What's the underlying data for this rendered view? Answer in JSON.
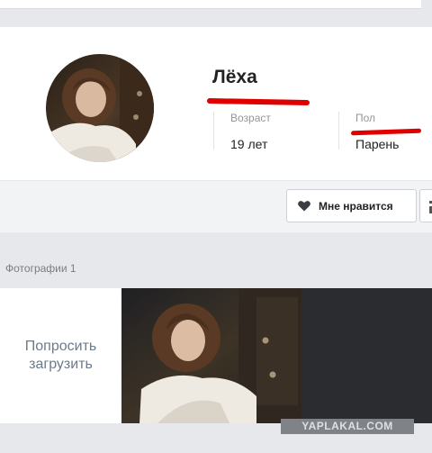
{
  "profile": {
    "name": "Лёха",
    "age_label": "Возраст",
    "age_value": "19 лет",
    "gender_label": "Пол",
    "gender_value": "Парень"
  },
  "actions": {
    "like_label": "Мне нравится"
  },
  "photos": {
    "title": "Фотографии 1",
    "request_label": "Попросить загрузить"
  },
  "watermark": "YAPLAKAL.COM",
  "colors": {
    "annotation_red": "#e00000",
    "accent_text": "#6c7a89"
  }
}
